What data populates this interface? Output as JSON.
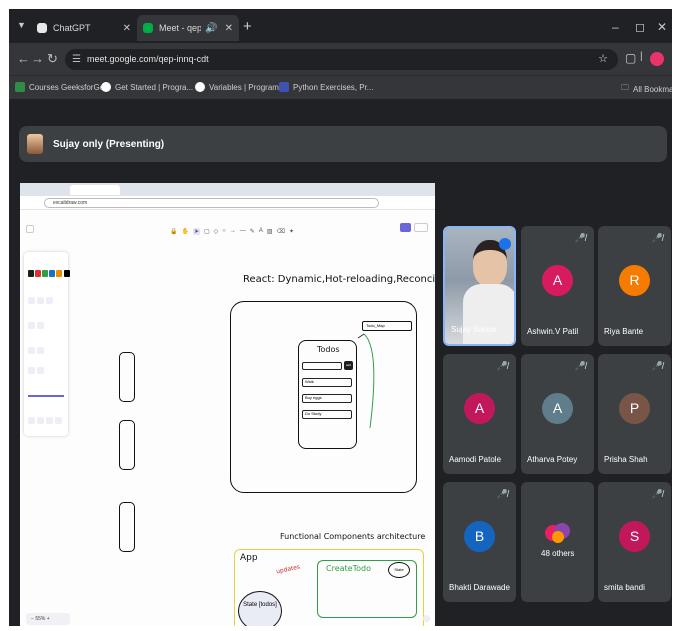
{
  "browser": {
    "tabs": [
      {
        "label": "ChatGPT",
        "active": false
      },
      {
        "label": "Meet - qep-innq-cdt",
        "active": true
      }
    ],
    "url": "meet.google.com/qep-innq-cdt",
    "bookmarks": [
      "Courses GeeksforGe...",
      "Get Started | Progra...",
      "Variables | Programi...",
      "Python Exercises, Pr..."
    ],
    "all_bookmarks": "All Bookmarks"
  },
  "meet": {
    "presenter_label": "Sujay only (Presenting)",
    "participants": [
      {
        "name": "Sujay Sarkar",
        "initial": "",
        "color": "#6a7a8e",
        "muted": false,
        "self": true
      },
      {
        "name": "Ashwin.V Patil",
        "initial": "A",
        "color": "#d81b60",
        "muted": true
      },
      {
        "name": "Riya Bante",
        "initial": "R",
        "color": "#f57c00",
        "muted": true
      },
      {
        "name": "Aamodi Patole",
        "initial": "A",
        "color": "#c2185b",
        "muted": true
      },
      {
        "name": "Atharva Potey",
        "initial": "A",
        "color": "#607d8b",
        "muted": true
      },
      {
        "name": "Prisha Shah",
        "initial": "P",
        "color": "#795548",
        "muted": true
      },
      {
        "name": "Bhakti Darawade",
        "initial": "B",
        "color": "#1565c0",
        "muted": true
      },
      {
        "name": "48 others",
        "initial": "",
        "color": "#3c4043",
        "muted": false
      },
      {
        "name": "smita bandi",
        "initial": "S",
        "color": "#c2185b",
        "muted": true
      }
    ]
  },
  "shared_screen": {
    "url": "excalidraw.com",
    "zoom": "55%",
    "title": "React: Dynamic,Hot-reloading,Reconciliation",
    "todos_title": "Todos",
    "todo_add": "add",
    "todo_items": [
      "Walk",
      "Buy eggs",
      "Do Study"
    ],
    "callout": "Todo_Map",
    "subtitle": "Functional Components architecture",
    "app_label": "App",
    "create_label": "CreateTodo",
    "state_label": "State",
    "updates_label": "updates",
    "state_todos": "State [todos]"
  }
}
